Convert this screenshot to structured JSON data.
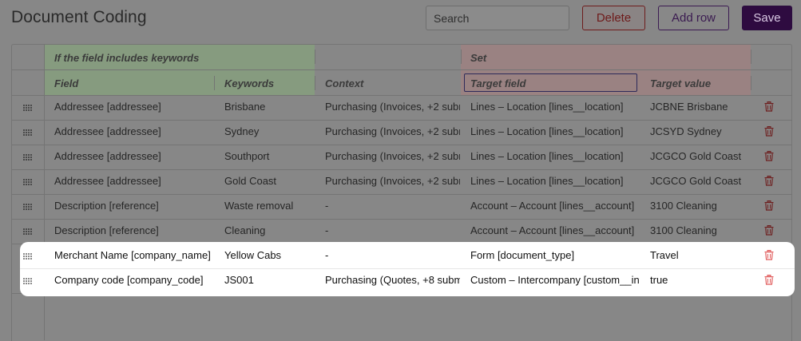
{
  "page": {
    "title": "Document Coding"
  },
  "toolbar": {
    "search_placeholder": "Search",
    "delete_label": "Delete",
    "add_row_label": "Add row",
    "save_label": "Save"
  },
  "table": {
    "group_headers": {
      "condition": "If the field includes keywords",
      "action": "Set"
    },
    "columns": {
      "field": "Field",
      "keywords": "Keywords",
      "context": "Context",
      "target_field": "Target field",
      "target_value": "Target value"
    },
    "rows": [
      {
        "field": "Addressee [addressee]",
        "keywords": "Brisbane",
        "context": "Purchasing (Invoices, +2 subm",
        "target_field": "Lines – Location [lines__location]",
        "target_value": "JCBNE Brisbane"
      },
      {
        "field": "Addressee [addressee]",
        "keywords": "Sydney",
        "context": "Purchasing (Invoices, +2 subm",
        "target_field": "Lines – Location [lines__location]",
        "target_value": "JCSYD Sydney"
      },
      {
        "field": "Addressee [addressee]",
        "keywords": "Southport",
        "context": "Purchasing (Invoices, +2 subm",
        "target_field": "Lines – Location [lines__location]",
        "target_value": "JCGCO Gold Coast"
      },
      {
        "field": "Addressee [addressee]",
        "keywords": "Gold Coast",
        "context": "Purchasing (Invoices, +2 subm",
        "target_field": "Lines – Location [lines__location]",
        "target_value": "JCGCO Gold Coast"
      },
      {
        "field": "Description [reference]",
        "keywords": "Waste removal",
        "context": "-",
        "target_field": "Account – Account [lines__account]",
        "target_value": "3100 Cleaning"
      },
      {
        "field": "Description [reference]",
        "keywords": "Cleaning",
        "context": "-",
        "target_field": "Account – Account [lines__account]",
        "target_value": "3100 Cleaning"
      },
      {
        "field": "Merchant Name [company_name]",
        "keywords": "Yellow Cabs",
        "context": "-",
        "target_field": "Form [document_type]",
        "target_value": "Travel"
      },
      {
        "field": "Company code [company_code]",
        "keywords": "JS001",
        "context": "Purchasing (Quotes, +8 subm",
        "target_field": "Custom – Intercompany [custom__int",
        "target_value": "true"
      }
    ]
  },
  "icons": {
    "drag": "drag-handle-icon",
    "delete": "trash-icon"
  },
  "colors": {
    "accent": "#4b1669",
    "danger": "#c62828"
  }
}
